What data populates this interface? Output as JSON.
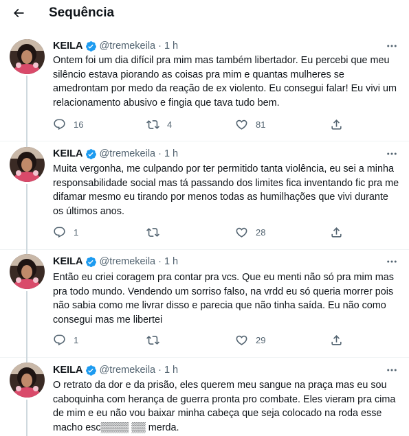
{
  "header": {
    "title": "Sequência"
  },
  "tweets": [
    {
      "name": "KEILA",
      "handle": "@tremekeila",
      "dot": "·",
      "time": "1 h",
      "text": "Ontem foi um dia difícil pra mim mas também libertador. Eu percebi que meu silêncio estava piorando as coisas pra mim e quantas mulheres se amedrontam por medo da reação de ex violento. Eu consegui falar! Eu vivi um relacionamento abusivo e fingia que tava tudo bem.",
      "replies": "16",
      "retweets": "4",
      "likes": "81"
    },
    {
      "name": "KEILA",
      "handle": "@tremekeila",
      "dot": "·",
      "time": "1 h",
      "text": "Muita vergonha, me culpando por ter permitido tanta violência, eu sei a minha responsabilidade social mas tá passando dos limites fica inventando fic pra me difamar mesmo eu tirando por menos todas as humilhações que vivi durante os últimos anos.",
      "replies": "1",
      "retweets": "",
      "likes": "28"
    },
    {
      "name": "KEILA",
      "handle": "@tremekeila",
      "dot": "·",
      "time": "1 h",
      "text": "Então eu criei coragem pra contar pra vcs. Que eu menti não só pra mim mas pra todo mundo. Vendendo um sorriso falso, na vrdd eu só queria morrer pois não sabia como me livrar disso e parecia que não tinha saída. Eu não como consegui mas me libertei",
      "replies": "1",
      "retweets": "",
      "likes": "29"
    },
    {
      "name": "KEILA",
      "handle": "@tremekeila",
      "dot": "·",
      "time": "1 h",
      "text": "O retrato da dor e da prisão, eles querem meu sangue na praça mas eu sou caboquinha com herança de guerra pronta pro combate. Eles vieram pra cima de mim e eu não vou baixar minha cabeça que seja colocado na roda esse macho esc▒▒▒▒ ▒▒ merda.",
      "replies": "",
      "retweets": "",
      "likes": ""
    }
  ],
  "colors": {
    "accent": "#1d9bf0",
    "secondary_text": "#536471",
    "divider": "#eff3f4",
    "thread_line": "#cfd9de"
  },
  "icons": [
    "back-arrow-icon",
    "verified-badge-icon",
    "more-icon",
    "reply-icon",
    "retweet-icon",
    "like-icon",
    "share-icon"
  ]
}
